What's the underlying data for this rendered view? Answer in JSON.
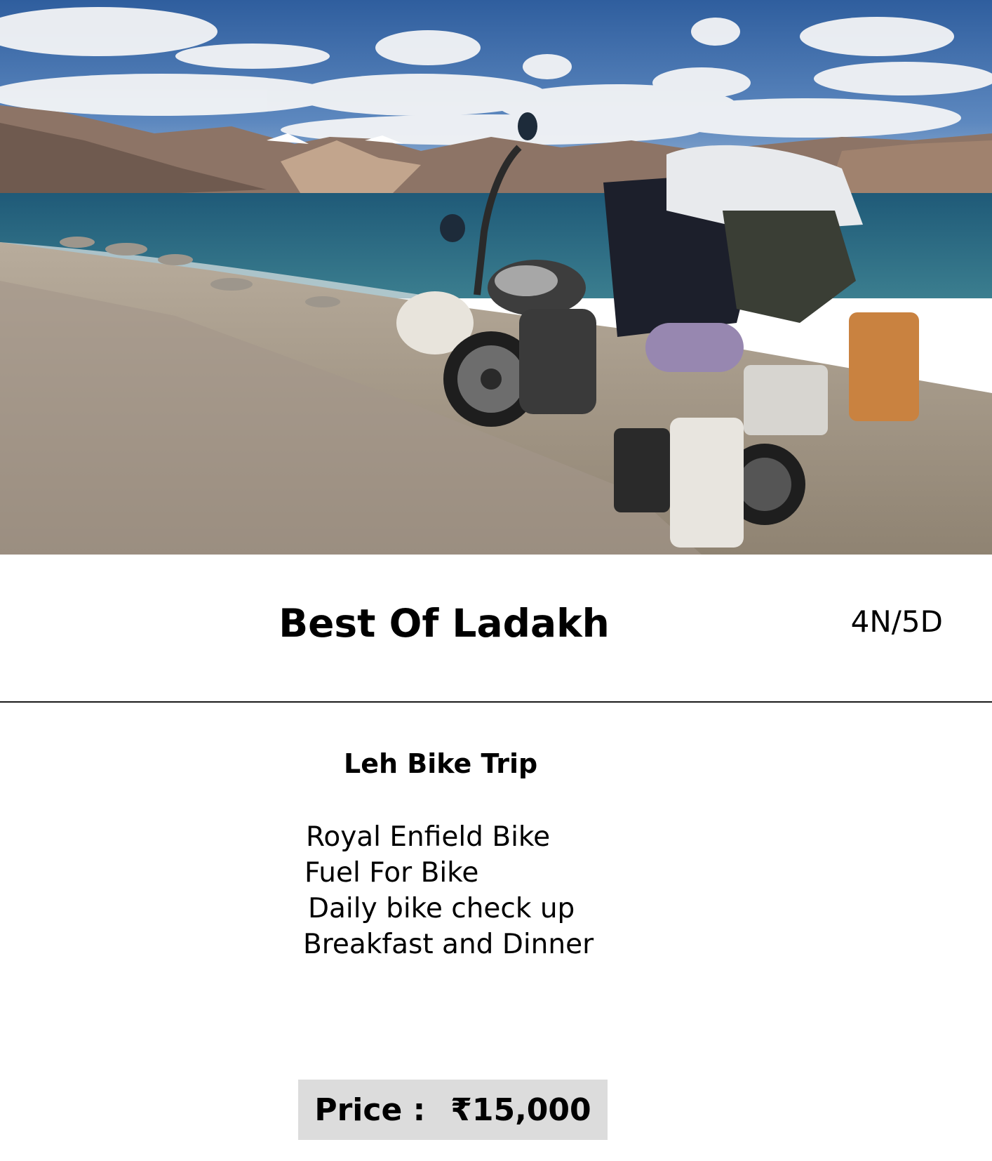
{
  "card": {
    "title": "Best Of Ladakh",
    "duration": "4N/5D",
    "subtitle": "Leh Bike Trip",
    "features": [
      "Royal Enfield Bike",
      "Fuel For Bike",
      "Daily bike check up",
      "Breakfast and Dinner"
    ],
    "price_label": "Price :",
    "price_value": "₹15,000"
  },
  "colors": {
    "price_box_bg": "#dcdcdc",
    "divider": "#1a1a1a",
    "text": "#000000"
  }
}
